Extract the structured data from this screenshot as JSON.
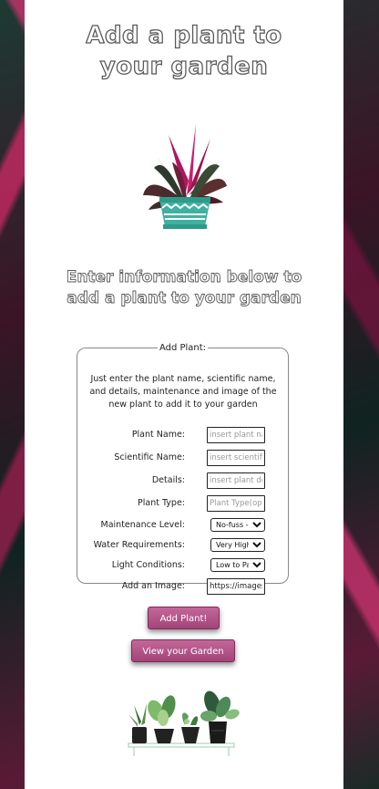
{
  "header": {
    "title_line1": "Add a plant to",
    "title_line2": "your garden"
  },
  "subtitle": {
    "line1": "Enter information below to",
    "line2": "add a plant to your garden"
  },
  "form": {
    "legend": "Add Plant:",
    "intro": "Just enter the plant name, scientific name, and details, maintenance and image of the new plant to add it to your garden",
    "fields": {
      "plant_name": {
        "label": "Plant Name:",
        "placeholder": "insert plant name"
      },
      "scientific_name": {
        "label": "Scientific Name:",
        "placeholder": "insert scientific name"
      },
      "details": {
        "label": "Details:",
        "placeholder": "insert plant details"
      },
      "plant_type": {
        "label": "Plant Type:",
        "placeholder": "Plant Type(optional)"
      },
      "maintenance": {
        "label": "Maintenance Level:",
        "value": "No-fuss --"
      },
      "water": {
        "label": "Water Requirements:",
        "value": "Very High"
      },
      "light": {
        "label": "Light Conditions:",
        "value": "Low to Partial"
      },
      "image": {
        "label": "Add an Image:",
        "value": "https://images"
      }
    }
  },
  "buttons": {
    "add_plant": "Add Plant!",
    "view_garden": "View your Garden"
  },
  "colors": {
    "button": "#b3558a",
    "panel": "#ffffff",
    "title_outline": "#5a5a5a"
  }
}
